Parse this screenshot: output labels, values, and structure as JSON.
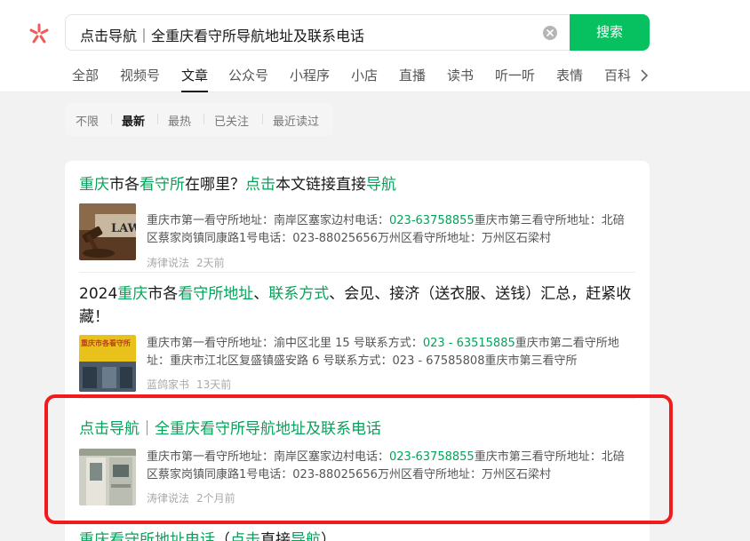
{
  "search": {
    "query": "点击导航｜全重庆看守所导航地址及联系电话",
    "button_label": "搜索"
  },
  "tabs": [
    {
      "label": "全部"
    },
    {
      "label": "视频号"
    },
    {
      "label": "文章"
    },
    {
      "label": "公众号"
    },
    {
      "label": "小程序"
    },
    {
      "label": "小店"
    },
    {
      "label": "直播"
    },
    {
      "label": "读书"
    },
    {
      "label": "听一听"
    },
    {
      "label": "表情"
    },
    {
      "label": "百科"
    }
  ],
  "active_tab": "文章",
  "filters": [
    {
      "label": "不限"
    },
    {
      "label": "最新"
    },
    {
      "label": "最热"
    },
    {
      "label": "已关注"
    },
    {
      "label": "最近读过"
    }
  ],
  "active_filter": "最新",
  "results": [
    {
      "title_parts": [
        {
          "text": "重庆",
          "hl": true
        },
        {
          "text": "市各",
          "hl": false
        },
        {
          "text": "看守所",
          "hl": true
        },
        {
          "text": "在哪里？",
          "hl": false
        },
        {
          "text": "点击",
          "hl": true
        },
        {
          "text": "本文链接直接",
          "hl": false
        },
        {
          "text": "导航",
          "hl": true
        }
      ],
      "snippet_parts": [
        {
          "text": "重庆市第一看守所地址：南岸区塞家边村电话：",
          "hl": false
        },
        {
          "text": "023-63758855",
          "hl": true
        },
        {
          "text": "重庆市第三看守所地址：北碚区蔡家岗镇同康路1号电话：023-88025656万州区看守所地址：万州区石梁村",
          "hl": false
        }
      ],
      "source": "涛律说法",
      "time": "2天前",
      "thumb_text": "LAW"
    },
    {
      "title_parts": [
        {
          "text": "2024",
          "hl": false
        },
        {
          "text": "重庆",
          "hl": true
        },
        {
          "text": "市各",
          "hl": false
        },
        {
          "text": "看守所地址",
          "hl": true
        },
        {
          "text": "、",
          "hl": false
        },
        {
          "text": "联系方式",
          "hl": true
        },
        {
          "text": "、会见、接济（送衣服、送钱）汇总，赶紧收藏！",
          "hl": false
        }
      ],
      "snippet_parts": [
        {
          "text": "重庆市第一看守所地址：渝中区北里 15 号联系方式：",
          "hl": false
        },
        {
          "text": "023 - 63515885",
          "hl": true
        },
        {
          "text": "重庆市第二看守所地址：重庆市江北区复盛镇盛安路 6 号联系方式：023 - 67585808重庆市第三看守所",
          "hl": false
        }
      ],
      "source": "蓝鸽家书",
      "time": "13天前",
      "thumb_text": "重庆市各看守所"
    },
    {
      "title": "点击导航｜全重庆看守所导航地址及联系电话",
      "snippet_parts": [
        {
          "text": "重庆市第一看守所地址：南岸区塞家边村电话：",
          "hl": false
        },
        {
          "text": "023-63758855",
          "hl": true
        },
        {
          "text": "重庆市第三看守所地址：北碚区蔡家岗镇同康路1号电话：023-88025656万州区看守所地址：万州区石梁村",
          "hl": false
        }
      ],
      "source": "涛律说法",
      "time": "2个月前"
    },
    {
      "title_parts": [
        {
          "text": "重庆看守所地址电话",
          "hl": true
        },
        {
          "text": "（",
          "hl": false
        },
        {
          "text": "点击",
          "hl": true
        },
        {
          "text": "直接",
          "hl": false
        },
        {
          "text": "导航",
          "hl": true
        },
        {
          "text": "）",
          "hl": false
        }
      ]
    }
  ],
  "colors": {
    "accent": "#07c160",
    "highlight_text": "#07a25a",
    "annotation_border": "#f21a1a"
  }
}
